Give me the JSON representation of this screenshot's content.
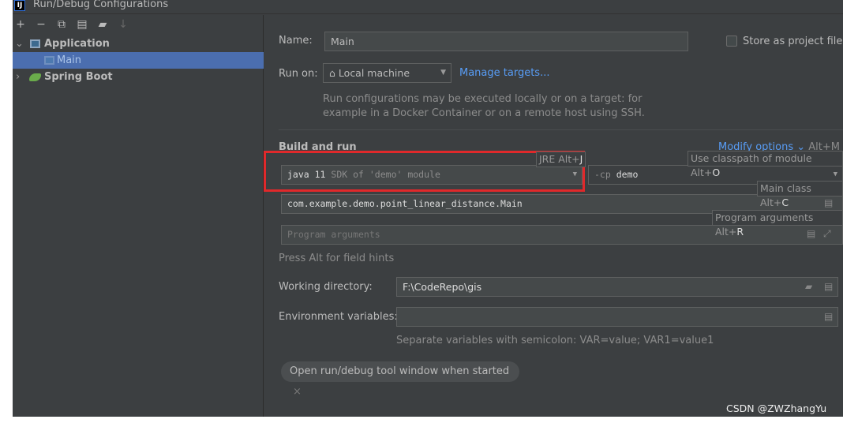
{
  "window": {
    "title": "Run/Debug Configurations",
    "logo": "IJ"
  },
  "sidebar": {
    "toolbar": [
      {
        "icon": "plus-icon",
        "glyph": "+"
      },
      {
        "icon": "minus-icon",
        "glyph": "−"
      },
      {
        "icon": "copy-icon",
        "glyph": "⧉"
      },
      {
        "icon": "save-icon",
        "glyph": "▤"
      },
      {
        "icon": "new-folder-icon",
        "glyph": "▰"
      },
      {
        "icon": "sort-icon",
        "glyph": "↓"
      }
    ],
    "tree": [
      {
        "label": "Application",
        "expanded": true
      },
      {
        "label": "Main",
        "selected": true
      },
      {
        "label": "Spring Boot",
        "expanded": false
      }
    ]
  },
  "form": {
    "name_label": "Name:",
    "name_value": "Main",
    "store_label": "Store as project file",
    "run_on_label": "Run on:",
    "run_on_value": "Local machine",
    "manage_targets": "Manage targets...",
    "run_on_help_1": "Run configurations may be executed locally or on a target: for",
    "run_on_help_2": "example in a Docker Container or on a remote host using SSH.",
    "build_run": "Build and run",
    "modify_options": "Modify options",
    "modify_shortcut": "Alt+M",
    "jre_value": "java 11",
    "jre_hint": "SDK of 'demo' module",
    "cp_prefix": "-cp",
    "cp_value": "demo",
    "main_class": "com.example.demo.point_linear_distance.Main",
    "program_args_placeholder": "Program arguments",
    "field_hints_text": "Press Alt for field hints",
    "workdir_label": "Working directory:",
    "workdir_value": "F:\\CodeRepo\\gis",
    "env_label": "Environment variables:",
    "env_value": "",
    "env_help": "Separate variables with semicolon: VAR=value; VAR1=value1",
    "chip": "Open run/debug tool window when started"
  },
  "hints": {
    "jre": "JRE Alt+",
    "jre_key": "J",
    "cp": "Use classpath of module Alt+",
    "cp_key": "O",
    "main": "Main class Alt+",
    "main_key": "C",
    "args": "Program arguments Alt+",
    "args_key": "R"
  },
  "watermark": "CSDN @ZWZhangYu",
  "colors": {
    "background": "#3c3f41",
    "selection": "#4b6eaf",
    "link": "#589df6",
    "highlight_box": "#e0292b"
  }
}
